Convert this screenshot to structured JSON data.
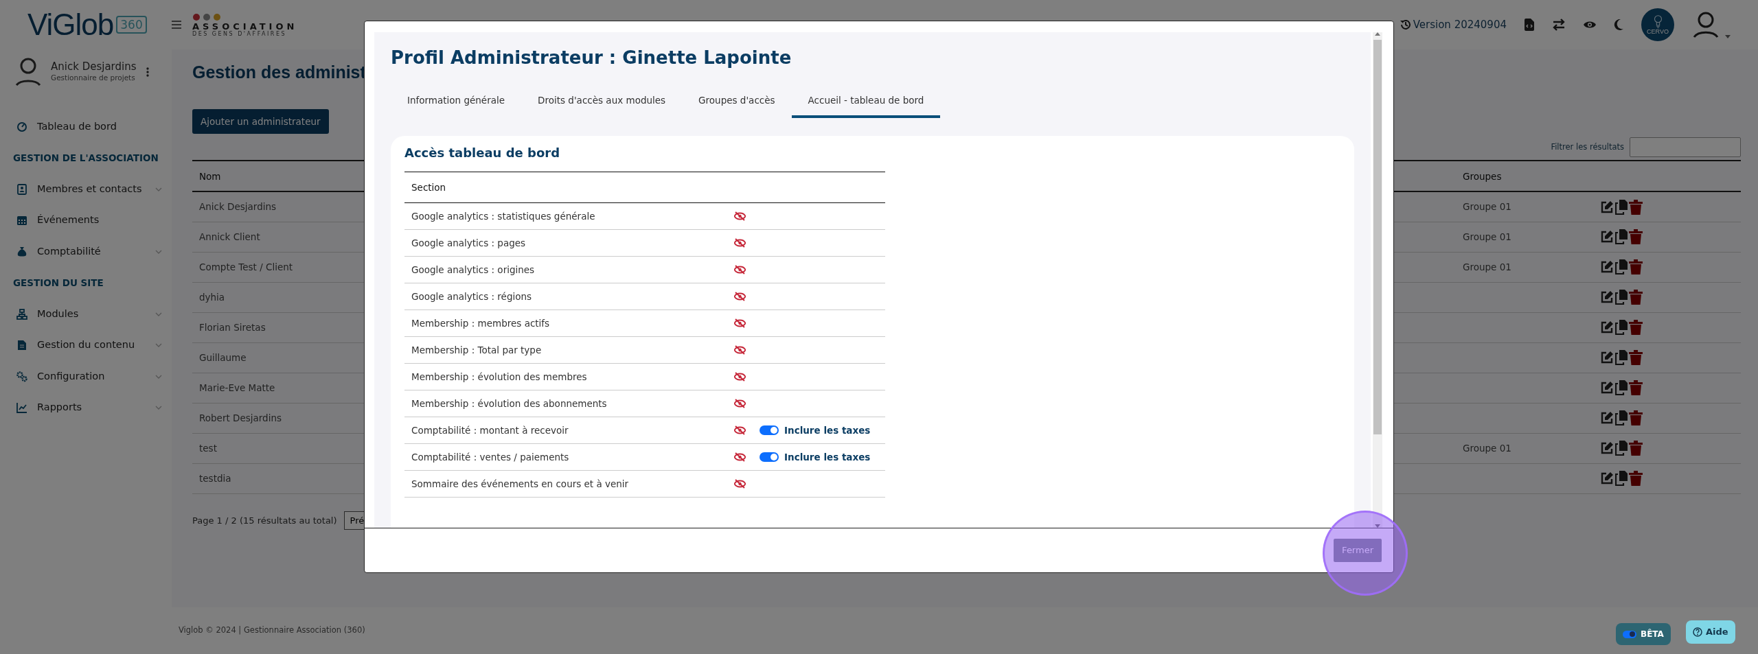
{
  "header": {
    "logo": "ViGlob",
    "logo_badge": "360",
    "org_logo": {
      "line1": "ASSOCIATION",
      "line2": "DES GENS D'AFFAIRES"
    },
    "version": "Version 20240904",
    "assistant_badge": "CERVO"
  },
  "sidebar": {
    "user": {
      "name": "Anick Desjardins",
      "role": "Gestionnaire de projets"
    },
    "items": [
      {
        "kind": "link",
        "label": "Tableau de bord",
        "has_submenu": false
      },
      {
        "kind": "heading",
        "label": "GESTION DE L'ASSOCIATION"
      },
      {
        "kind": "link",
        "label": "Membres et contacts",
        "has_submenu": true
      },
      {
        "kind": "link",
        "label": "Événements",
        "has_submenu": false
      },
      {
        "kind": "link",
        "label": "Comptabilité",
        "has_submenu": true
      },
      {
        "kind": "heading",
        "label": "GESTION DU SITE"
      },
      {
        "kind": "link",
        "label": "Modules",
        "has_submenu": true
      },
      {
        "kind": "link",
        "label": "Gestion du contenu",
        "has_submenu": true
      },
      {
        "kind": "link",
        "label": "Configuration",
        "has_submenu": true
      },
      {
        "kind": "link",
        "label": "Rapports",
        "has_submenu": true
      }
    ]
  },
  "main": {
    "title": "Gestion des administ",
    "add_button": "Ajouter un administrateur",
    "filter": {
      "label": "Filtrer les résultats"
    },
    "table": {
      "columns": [
        "Nom",
        "Groupes"
      ],
      "rows": [
        {
          "name": "Anick Desjardins",
          "group": "Groupe 01"
        },
        {
          "name": "Annick Client",
          "group": "Groupe 01"
        },
        {
          "name": "Compte Test / Client",
          "group": "Groupe 01"
        },
        {
          "name": "dyhia"
        },
        {
          "name": "Florian Siretas"
        },
        {
          "name": "Guillaume"
        },
        {
          "name": "Marie-Eve Matte"
        },
        {
          "name": "Robert Desjardins"
        },
        {
          "name": "test",
          "group": "Groupe 01"
        },
        {
          "name": "testdia"
        }
      ]
    },
    "pagination": {
      "summary": "Page 1 / 2 (15 résultats au total)",
      "previous": "Pré"
    }
  },
  "footer": {
    "text": "Viglob © 2024 | Gestionnaire Association (360)",
    "beta": {
      "label": "BÊTA",
      "on": true
    },
    "help": "Aide"
  },
  "modal": {
    "title": "Profil Administrateur : Ginette Lapointe",
    "tabs": [
      {
        "label": "Information générale",
        "selected": false
      },
      {
        "label": "Droits d'accès aux modules",
        "selected": false
      },
      {
        "label": "Groupes d'accès",
        "selected": false
      },
      {
        "label": "Accueil - tableau de bord",
        "selected": true
      }
    ],
    "card_title": "Accès tableau de bord",
    "column": "Section",
    "rows": [
      {
        "label": "Google analytics : statistiques générale",
        "visible": false
      },
      {
        "label": "Google analytics : pages",
        "visible": false
      },
      {
        "label": "Google analytics : origines",
        "visible": false
      },
      {
        "label": "Google analytics : régions",
        "visible": false
      },
      {
        "label": "Membership : membres actifs",
        "visible": false
      },
      {
        "label": "Membership : Total par type",
        "visible": false
      },
      {
        "label": "Membership : évolution des membres",
        "visible": false
      },
      {
        "label": "Membership : évolution des abonnements",
        "visible": false
      },
      {
        "label": "Comptabilité : montant à recevoir",
        "visible": false,
        "toggle": {
          "label": "Inclure les taxes",
          "on": true
        }
      },
      {
        "label": "Comptabilité : ventes / paiements",
        "visible": false,
        "toggle": {
          "label": "Inclure les taxes",
          "on": true
        }
      },
      {
        "label": "Sommaire des événements en cours et à venir",
        "visible": false
      }
    ],
    "close_button": "Fermer"
  }
}
